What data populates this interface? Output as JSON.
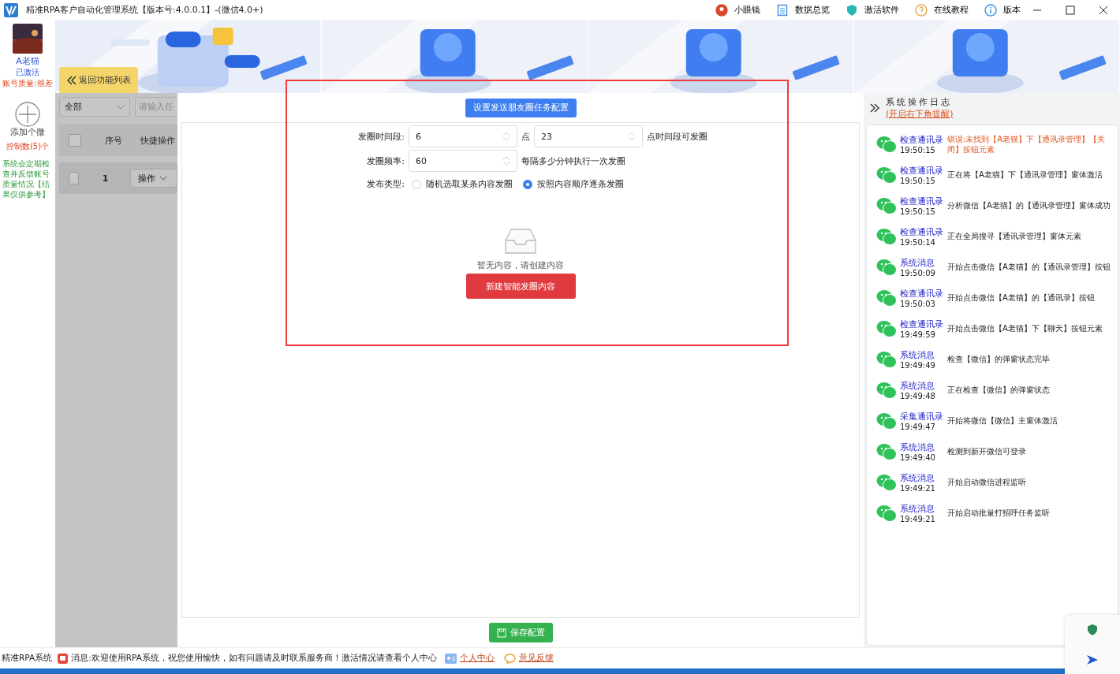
{
  "window": {
    "title": "精准RPA客户自动化管理系统【版本号:4.0.0.1】-(微信4.0+)"
  },
  "toolbar": [
    {
      "label": "小眼镜"
    },
    {
      "label": "数据总览"
    },
    {
      "label": "激活软件"
    },
    {
      "label": "在线教程"
    },
    {
      "label": "版本"
    }
  ],
  "sidebar": {
    "name": "A老猫",
    "status": "已激活",
    "quality": "账号质量:很差",
    "add_label": "添加个微",
    "control_count": "控制数(5)个",
    "note": "系统会定期检查并反馈账号质量情况【结果仅供参考】"
  },
  "banner": {
    "back_button": "返回功能列表"
  },
  "list_panel": {
    "filter": "全部",
    "search_placeholder": "请输入任",
    "columns": [
      "序号",
      "快捷操作"
    ],
    "rows": [
      {
        "index": "1",
        "action": "操作",
        "checked": false
      }
    ],
    "header_checked": false
  },
  "config": {
    "title_button": "设置发送朋友圈任务配置",
    "time_label": "发圈时间段:",
    "start_hour": "6",
    "hour_unit": "点",
    "end_hour": "23",
    "time_hint": "点时间段可发圈",
    "freq_label": "发圈频率:",
    "frequency": "60",
    "freq_hint": "每隔多少分钟执行一次发圈",
    "type_label": "发布类型:",
    "types": [
      {
        "label": "随机选取某条内容发圈",
        "selected": false
      },
      {
        "label": "按照内容顺序逐条发圈",
        "selected": true
      }
    ],
    "empty_text": "暂无内容，请创建内容",
    "create_button": "新建智能发圈内容",
    "save_button": "保存配置"
  },
  "log": {
    "title": "系统操作日志",
    "link": "(开启右下角提醒)",
    "entries": [
      {
        "category": "检查通讯录",
        "time": "19:50:15",
        "message": "错误:未找到【A老猫】下【通讯录管理】【关闭】按钮元素",
        "kind": "error"
      },
      {
        "category": "检查通讯录",
        "time": "19:50:15",
        "message": "正在将【A老猫】下【通讯录管理】窗体激活",
        "kind": "info"
      },
      {
        "category": "检查通讯录",
        "time": "19:50:15",
        "message": "分析微信【A老猫】的【通讯录管理】窗体成功",
        "kind": "info"
      },
      {
        "category": "检查通讯录",
        "time": "19:50:14",
        "message": "正在全局搜寻【通讯录管理】窗体元素",
        "kind": "info"
      },
      {
        "category": "系统消息",
        "time": "19:50:09",
        "message": "开始点击微信【A老猫】的【通讯录管理】按钮",
        "kind": "info"
      },
      {
        "category": "检查通讯录",
        "time": "19:50:03",
        "message": "开始点击微信【A老猫】的【通讯录】按钮",
        "kind": "info"
      },
      {
        "category": "检查通讯录",
        "time": "19:49:59",
        "message": "开始点击微信【A老猫】下【聊天】按钮元素",
        "kind": "info"
      },
      {
        "category": "系统消息",
        "time": "19:49:49",
        "message": "检查【微信】的弹窗状态完毕",
        "kind": "info"
      },
      {
        "category": "系统消息",
        "time": "19:49:48",
        "message": "正在检查【微信】的弹窗状态",
        "kind": "info"
      },
      {
        "category": "采集通讯录",
        "time": "19:49:47",
        "message": "开始将微信【微信】主窗体激活",
        "kind": "info"
      },
      {
        "category": "系统消息",
        "time": "19:49:40",
        "message": "检测到新开微信可登录",
        "kind": "info"
      },
      {
        "category": "系统消息",
        "time": "19:49:21",
        "message": "开始启动微信进程监听",
        "kind": "info"
      },
      {
        "category": "系统消息",
        "time": "19:49:21",
        "message": "开始启动批量打招呼任务监听",
        "kind": "info"
      }
    ]
  },
  "status_bar": {
    "app": "精准RPA系统",
    "message": "消息:欢迎使用RPA系统，祝您使用愉快，如有问题请及时联系服务商！激活情况请查看个人中心",
    "links": [
      "个人中心",
      "意见反馈"
    ]
  }
}
